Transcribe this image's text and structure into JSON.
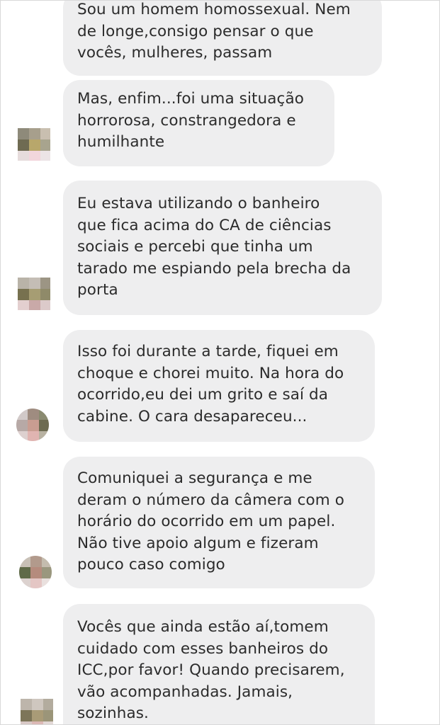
{
  "messages": [
    {
      "lines": [
        "Sou um homem homossexual. Nem",
        "de longe,consigo pensar o que",
        "vocês, mulheres, passam"
      ]
    },
    {
      "lines": [
        "Mas, enfim...foi uma situação",
        "horrorosa, constrangedora e",
        "humilhante"
      ]
    },
    {
      "lines": [
        "Eu estava utilizando o banheiro",
        "que fica acima do CA de ciências",
        "sociais e percebi que tinha um",
        "tarado me espiando pela brecha da",
        "porta"
      ]
    },
    {
      "lines": [
        "Isso foi durante a tarde, fiquei em",
        "choque e chorei muito. Na hora do",
        "ocorrido,eu dei um grito e saí da",
        "cabine. O cara desapareceu..."
      ]
    },
    {
      "lines": [
        "Comuniquei a segurança e me",
        "deram o número da câmera com o",
        "horário do ocorrido em um papel.",
        "Não tive apoio algum e fizeram",
        "pouco caso comigo"
      ]
    },
    {
      "lines": [
        "Vocês que ainda estão aí,tomem",
        "cuidado com esses banheiros do",
        "ICC,por favor! Quando precisarem,",
        "vão acompanhadas. Jamais,",
        "sozinhas."
      ]
    }
  ],
  "avatar_icon": "blurred-profile-avatar",
  "colors": {
    "bubble_bg": "#eeeeef",
    "text": "#2b2b2b",
    "background": "#ffffff"
  }
}
